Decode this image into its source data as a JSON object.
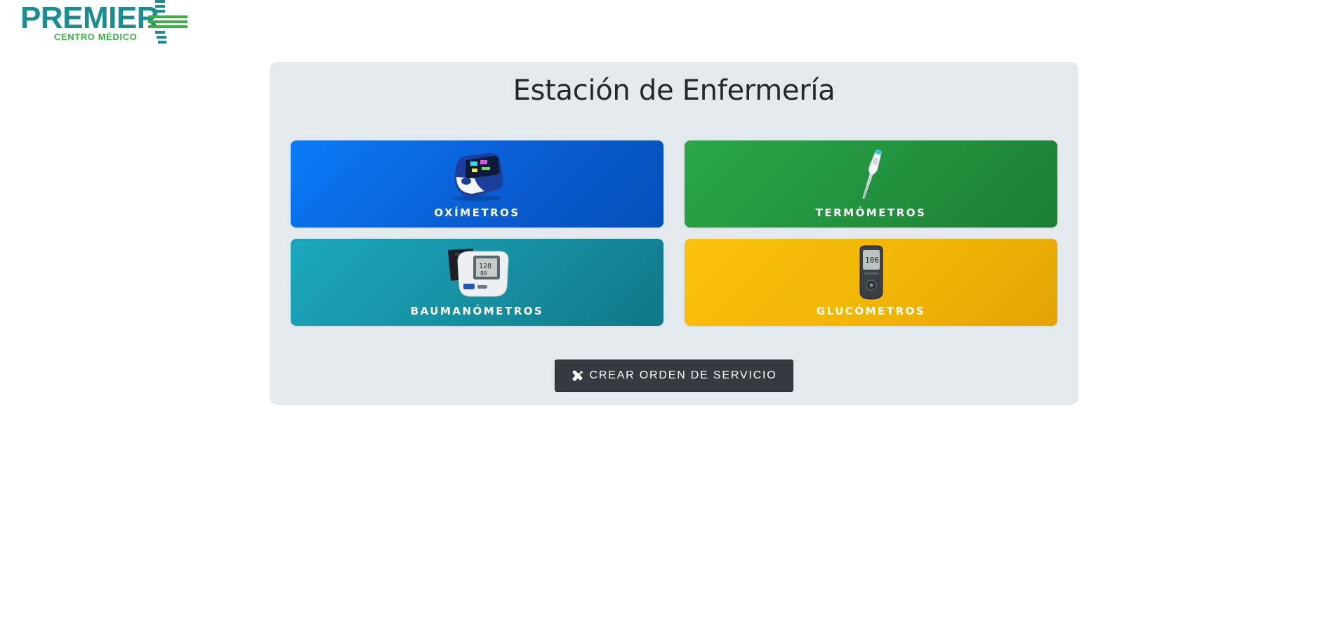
{
  "brand": {
    "name": "PREMIER",
    "tagline": "CENTRO MÉDICO",
    "color_primary": "#1a8c92",
    "color_secondary": "#3fae49"
  },
  "panel": {
    "title": "Estación de Enfermería",
    "background": "#e3e9ec"
  },
  "tiles": [
    {
      "label": "OXÍMETROS",
      "icon": "pulse-oximeter-icon",
      "color": "#0a6ee6"
    },
    {
      "label": "TERMÓMETROS",
      "icon": "thermometer-icon",
      "color": "#24963f"
    },
    {
      "label": "BAUMANÓMETROS",
      "icon": "blood-pressure-monitor-icon",
      "color": "#178ea1"
    },
    {
      "label": "GLUCÓMETROS",
      "icon": "glucometer-icon",
      "color": "#f2b506"
    }
  ],
  "devices": {
    "glucometer_reading": "106"
  },
  "actions": {
    "create_order_label": "CREAR ORDEN DE SERVICIO",
    "create_order_icon": "tools-icon",
    "button_color": "#343a40"
  }
}
